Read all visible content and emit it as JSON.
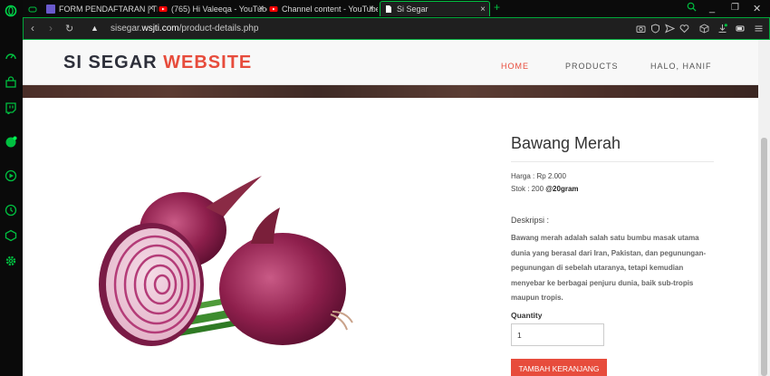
{
  "browser": {
    "tabs": [
      {
        "title": "FORM PENDAFTARAN | TII",
        "icon": "form-icon",
        "color": "#6a5acd"
      },
      {
        "title": "(765) Hi Valeeqa - YouTube",
        "icon": "youtube-icon",
        "color": "#ff0000"
      },
      {
        "title": "Channel content - YouTube",
        "icon": "youtube-icon",
        "color": "#ff0000"
      },
      {
        "title": "Si Segar",
        "icon": "page-icon",
        "color": "#ffffff"
      }
    ],
    "url_prefix": "sisegar.",
    "url_domain": "wsjti.com",
    "url_path": "/product-details.php",
    "accent": "#00c040"
  },
  "site": {
    "logo_part1": "SI SEGAR ",
    "logo_part2": "WEBSITE",
    "nav": [
      "HOME",
      "PRODUCTS",
      "HALO, HANIF"
    ],
    "accent": "#e74c3c"
  },
  "product": {
    "name": "Bawang Merah",
    "price_line": "Harga : Rp 2.000",
    "stock_prefix": "Stok : 200 ",
    "stock_unit": "@20gram",
    "desc_label": "Deskripsi :",
    "description": "Bawang merah adalah salah satu bumbu masak utama dunia yang berasal dari Iran, Pakistan, dan pegunungan-pegunungan di sebelah utaranya, tetapi kemudian menyebar ke berbagai penjuru dunia, baik sub-tropis maupun tropis.",
    "quantity_label": "Quantity",
    "quantity_value": "1",
    "button_label": "TAMBAH KERANJANG"
  }
}
